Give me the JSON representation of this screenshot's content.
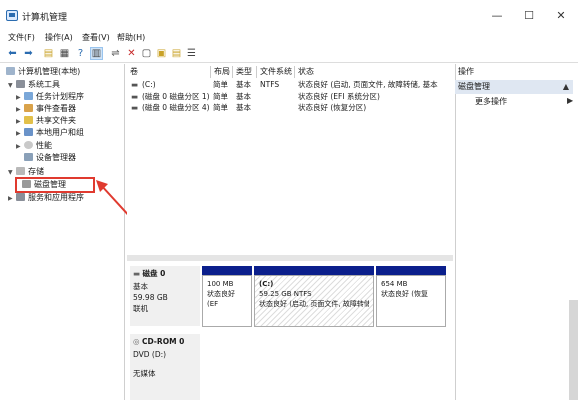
{
  "window": {
    "title": "计算机管理",
    "minimize": "—",
    "maximize": "☐",
    "close": "✕"
  },
  "menu": [
    "文件(F)",
    "操作(A)",
    "查看(V)",
    "帮助(H)"
  ],
  "tree": {
    "root": "计算机管理(本地)",
    "system_tools": "系统工具",
    "task_scheduler": "任务计划程序",
    "event_viewer": "事件查看器",
    "shared_folders": "共享文件夹",
    "local_users": "本地用户和组",
    "performance": "性能",
    "device_manager": "设备管理器",
    "storage": "存储",
    "disk_management": "磁盘管理",
    "services": "服务和应用程序"
  },
  "columns": [
    "卷",
    "布局",
    "类型",
    "文件系统",
    "状态"
  ],
  "volumes": [
    {
      "name": "(C:)",
      "layout": "简单",
      "type": "基本",
      "fs": "NTFS",
      "status": "状态良好 (启动, 页面文件, 故障转储, 基本"
    },
    {
      "name": "(磁盘 0 磁盘分区 1)",
      "layout": "简单",
      "type": "基本",
      "fs": "",
      "status": "状态良好 (EFI 系统分区)"
    },
    {
      "name": "(磁盘 0 磁盘分区 4)",
      "layout": "简单",
      "type": "基本",
      "fs": "",
      "status": "状态良好 (恢复分区)"
    }
  ],
  "disk0": {
    "name": "磁盘 0",
    "type": "基本",
    "size": "59.98 GB",
    "state": "联机",
    "partitions": [
      {
        "title": "",
        "size": "100 MB",
        "status": "状态良好 (EF"
      },
      {
        "title": "(C:)",
        "size": "59.25 GB NTFS",
        "status": "状态良好 (启动, 页面文件, 故障转储"
      },
      {
        "title": "",
        "size": "654 MB",
        "status": "状态良好 (恢复"
      }
    ]
  },
  "cdrom": {
    "name": "CD-ROM 0",
    "drive": "DVD (D:)",
    "media": "无媒体"
  },
  "actions": {
    "title": "操作",
    "selected": "磁盘管理",
    "more": "更多操作"
  },
  "colors": {
    "accent": "#0b1f8c",
    "highlight": "#e03a2f",
    "selection": "#dfe7f2"
  }
}
